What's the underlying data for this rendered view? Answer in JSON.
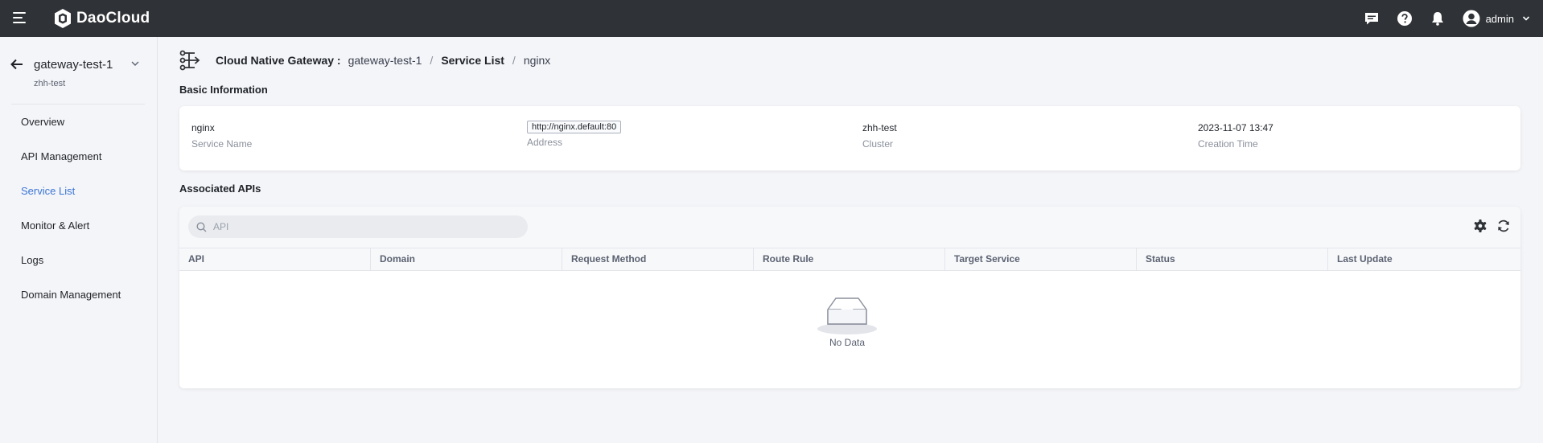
{
  "topbar": {
    "brand": "DaoCloud",
    "user": "admin",
    "icons": [
      "message-icon",
      "help-icon",
      "bell-icon",
      "user-avatar-icon",
      "chevron-down-icon"
    ]
  },
  "sidebar": {
    "workspace": "gateway-test-1",
    "workspace_sub": "zhh-test",
    "items": [
      {
        "label": "Overview"
      },
      {
        "label": "API Management"
      },
      {
        "label": "Service List"
      },
      {
        "label": "Monitor & Alert"
      },
      {
        "label": "Logs"
      },
      {
        "label": "Domain Management"
      }
    ],
    "active_item": "Service List"
  },
  "breadcrumb": {
    "title": "Cloud Native Gateway :",
    "gateway": "gateway-test-1",
    "current": "Service List",
    "leaf": "nginx",
    "separator": "/"
  },
  "basic_info": {
    "section_title": "Basic Information",
    "fields": [
      {
        "value": "nginx",
        "label": "Service Name"
      },
      {
        "value": "http://nginx.default:80",
        "label": "Address"
      },
      {
        "value": "zhh-test",
        "label": "Cluster"
      },
      {
        "value": "2023-11-07 13:47",
        "label": "Creation Time"
      }
    ]
  },
  "associated_apis": {
    "section_title": "Associated APIs",
    "search_placeholder": "API",
    "columns": [
      "API",
      "Domain",
      "Request Method",
      "Route Rule",
      "Target Service",
      "Status",
      "Last Update"
    ],
    "rows": [],
    "empty_text": "No Data"
  },
  "colors": {
    "topbar": "#2f3236",
    "accent": "#3a75d6",
    "page_bg": "#f4f5f8"
  }
}
